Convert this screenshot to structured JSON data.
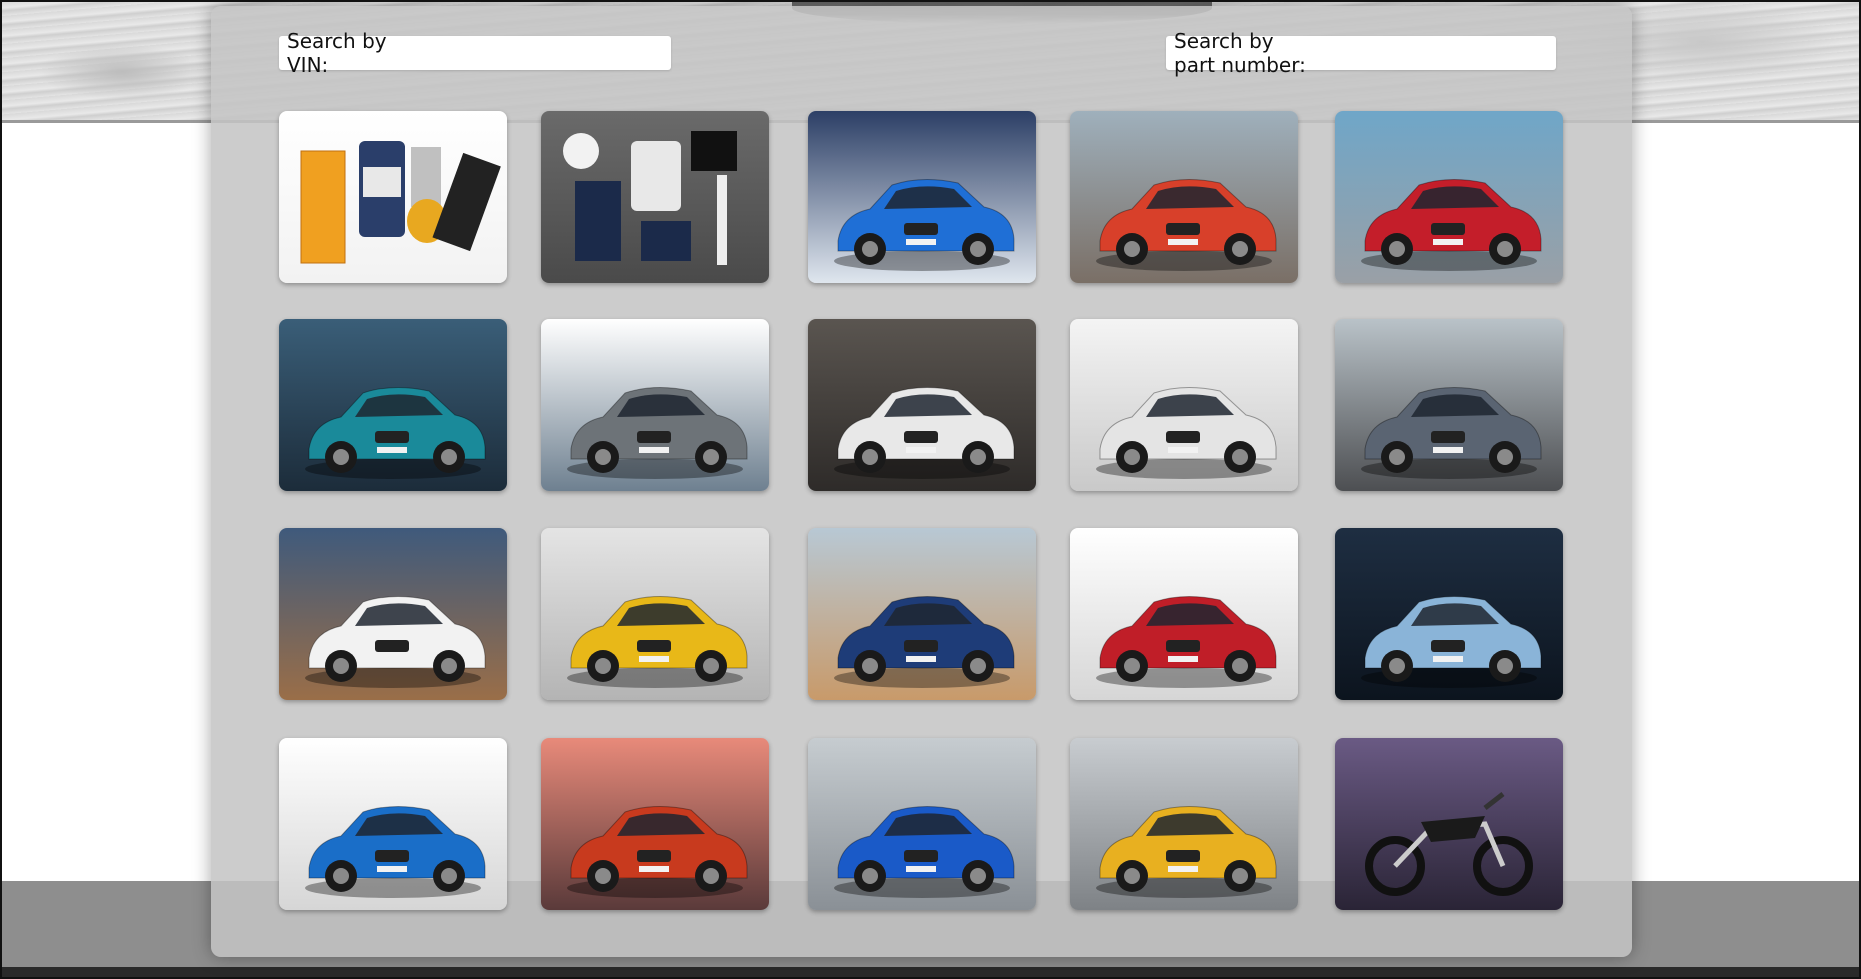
{
  "search": {
    "vin_label": "Search by VIN:",
    "vin_value": "",
    "part_label": "Search by part number:",
    "part_value": ""
  },
  "colors": {
    "panel": "#c4c4c4",
    "tile_bg_white": "#ffffff"
  },
  "tiles": [
    {
      "icon": "service-parts-image",
      "scene": "white",
      "subject": "parts",
      "color": "#f0a020"
    },
    {
      "icon": "lifestyle-collection-image",
      "scene": "grey",
      "subject": "apparel",
      "color": "#1b2a4a"
    },
    {
      "icon": "hatchback-image",
      "scene": "blue-street",
      "subject": "car",
      "color": "#1f6fd6"
    },
    {
      "icon": "tourer-image",
      "scene": "modern-house",
      "subject": "car",
      "color": "#d8402a"
    },
    {
      "icon": "sedan-image",
      "scene": "harbor",
      "subject": "car",
      "color": "#c41e2a"
    },
    {
      "icon": "gran-coupe-image",
      "scene": "ocean",
      "subject": "car",
      "color": "#1a8a9a"
    },
    {
      "icon": "sedan-image",
      "scene": "white-road",
      "subject": "car",
      "color": "#6d7378"
    },
    {
      "icon": "gran-turismo-image",
      "scene": "tunnel",
      "subject": "car",
      "color": "#e8e8e8"
    },
    {
      "icon": "luxury-sedan-image",
      "scene": "studio",
      "subject": "car",
      "color": "#e4e4e4"
    },
    {
      "icon": "coupe-image",
      "scene": "mountain",
      "subject": "car",
      "color": "#5a6472"
    },
    {
      "icon": "suv-image",
      "scene": "sky-dirt",
      "subject": "car",
      "color": "#f2f2f2"
    },
    {
      "icon": "suv-coupe-image",
      "scene": "brick-wall",
      "subject": "car",
      "color": "#e8b818"
    },
    {
      "icon": "suv-image",
      "scene": "desert",
      "subject": "car",
      "color": "#1e3c78"
    },
    {
      "icon": "suv-coupe-image",
      "scene": "white-building",
      "subject": "car",
      "color": "#c01e28"
    },
    {
      "icon": "suv-image",
      "scene": "night-street",
      "subject": "car",
      "color": "#8ab4d8"
    },
    {
      "icon": "suv-coupe-image",
      "scene": "white-building",
      "subject": "car",
      "color": "#1a6ec8"
    },
    {
      "icon": "roadster-image",
      "scene": "red-haze",
      "subject": "car",
      "color": "#c83a1e"
    },
    {
      "icon": "hybrid-sports-car-image",
      "scene": "garage",
      "subject": "car",
      "color": "#1a5ac8"
    },
    {
      "icon": "mini-hatch-image",
      "scene": "overcast",
      "subject": "car",
      "color": "#e8b020"
    },
    {
      "icon": "motorcycle-image",
      "scene": "purple-wall",
      "subject": "bike",
      "color": "#1a1a1a"
    }
  ]
}
